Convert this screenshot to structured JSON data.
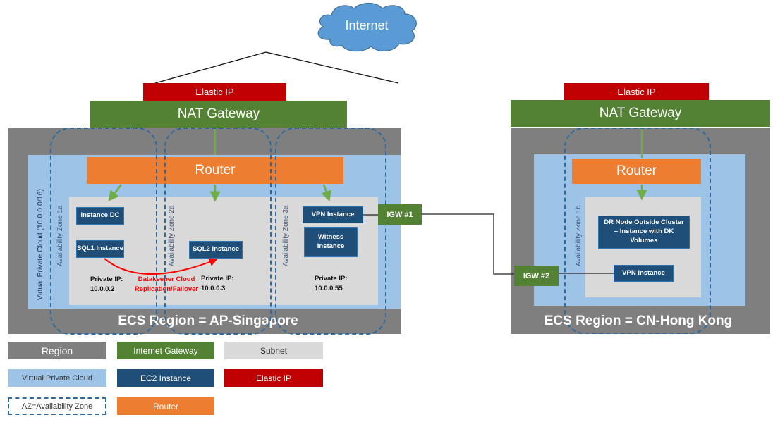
{
  "internet": {
    "label": "Internet"
  },
  "singapore": {
    "elastic_ip": "Elastic IP",
    "nat_gateway": "NAT Gateway",
    "router": "Router",
    "vpc_label": "Virtual Private Cloud (10.0.0.0/16)",
    "region_title": "ECS Region = AP-Singapore",
    "zones": [
      {
        "label": "Availability Zone 1a"
      },
      {
        "label": "Availability Zone 2a"
      },
      {
        "label": "Availability Zone 3a"
      }
    ],
    "instances": {
      "dc": "Instance DC",
      "sql1": "SQL1 Instance",
      "sql2": "SQL2 Instance",
      "vpn": "VPN Instance",
      "witness": "Witness Instance"
    },
    "ips": [
      {
        "label": "Private IP:",
        "value": "10.0.0.2"
      },
      {
        "label": "Private IP:",
        "value": "10.0.0.3"
      },
      {
        "label": "Private IP:",
        "value": "10.0.0.55"
      }
    ],
    "replication": {
      "line1": "Datakeeper Cloud",
      "line2": "Replication/Failover"
    },
    "igw": "IGW #1"
  },
  "hongkong": {
    "elastic_ip": "Elastic IP",
    "nat_gateway": "NAT Gateway",
    "router": "Router",
    "region_title": "ECS Region = CN-Hong Kong",
    "zone": {
      "label": "Availability Zone 1b"
    },
    "instances": {
      "dr": "DR Node Outside Cluster – Instance with DK Volumes",
      "vpn": "VPN Instance"
    },
    "igw": "IGW #2"
  },
  "legend": {
    "region": "Region",
    "internet_gateway": "Internet Gateway",
    "subnet": "Subnet",
    "vpc": "Virtual Private Cloud",
    "ec2": "EC2 Instance",
    "elastic_ip": "Elastic IP",
    "az": "AZ=Availability Zone",
    "router": "Router"
  },
  "colors": {
    "region": "#7f7f7f",
    "vpc": "#9dc3e6",
    "subnet": "#d9d9d9",
    "internet_gateway": "#548235",
    "ec2": "#1f4e79",
    "elastic_ip": "#c00000",
    "router": "#ed7d31",
    "az_border": "#2e6aa0",
    "cloud": "#5b9bd5",
    "replication": "#ff0000"
  }
}
